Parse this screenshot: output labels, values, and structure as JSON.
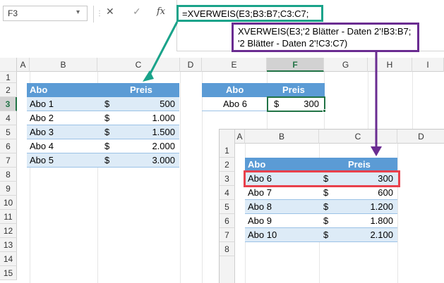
{
  "formula_bar": {
    "name_box": "F3",
    "cancel_icon": "✕",
    "enter_icon": "✓",
    "fx_label": "fx",
    "formula": "=XVERWEIS(E3;B3:B7;C3:C7;",
    "popup_line1": "XVERWEIS(E3;'2 Blätter - Daten 2'!B3:B7;",
    "popup_line2": "'2 Blätter - Daten 2'!C3:C7)"
  },
  "sheet1": {
    "columns": [
      "A",
      "B",
      "C",
      "D",
      "E",
      "F",
      "G",
      "H",
      "I"
    ],
    "rows": [
      "1",
      "2",
      "3",
      "4",
      "5",
      "6",
      "7",
      "8",
      "9",
      "10",
      "11",
      "12",
      "13",
      "14",
      "15"
    ],
    "table1": {
      "header_abo": "Abo",
      "header_preis": "Preis",
      "rows": [
        {
          "abo": "Abo 1",
          "cur": "$",
          "preis": "500"
        },
        {
          "abo": "Abo 2",
          "cur": "$",
          "preis": "1.000"
        },
        {
          "abo": "Abo 3",
          "cur": "$",
          "preis": "1.500"
        },
        {
          "abo": "Abo 4",
          "cur": "$",
          "preis": "2.000"
        },
        {
          "abo": "Abo 5",
          "cur": "$",
          "preis": "3.000"
        }
      ]
    },
    "lookup": {
      "header_abo": "Abo",
      "header_preis": "Preis",
      "abo": "Abo 6",
      "cur": "$",
      "preis": "300"
    }
  },
  "sheet2": {
    "columns": [
      "A",
      "B",
      "C",
      "D"
    ],
    "rows": [
      "1",
      "2",
      "3",
      "4",
      "5",
      "6",
      "7",
      "8"
    ],
    "header_abo": "Abo",
    "header_preis": "Preis",
    "data": [
      {
        "abo": "Abo 6",
        "cur": "$",
        "preis": "300"
      },
      {
        "abo": "Abo 7",
        "cur": "$",
        "preis": "600"
      },
      {
        "abo": "Abo 8",
        "cur": "$",
        "preis": "1.200"
      },
      {
        "abo": "Abo 9",
        "cur": "$",
        "preis": "1.800"
      },
      {
        "abo": "Abo 10",
        "cur": "$",
        "preis": "2.100"
      }
    ]
  },
  "colors": {
    "header_blue": "#5b9bd5",
    "band_blue": "#ddebf7",
    "annotation_green": "#1aa38a",
    "annotation_purple": "#6a2c91",
    "highlight_red": "#e8414c",
    "selection_green": "#217346"
  }
}
